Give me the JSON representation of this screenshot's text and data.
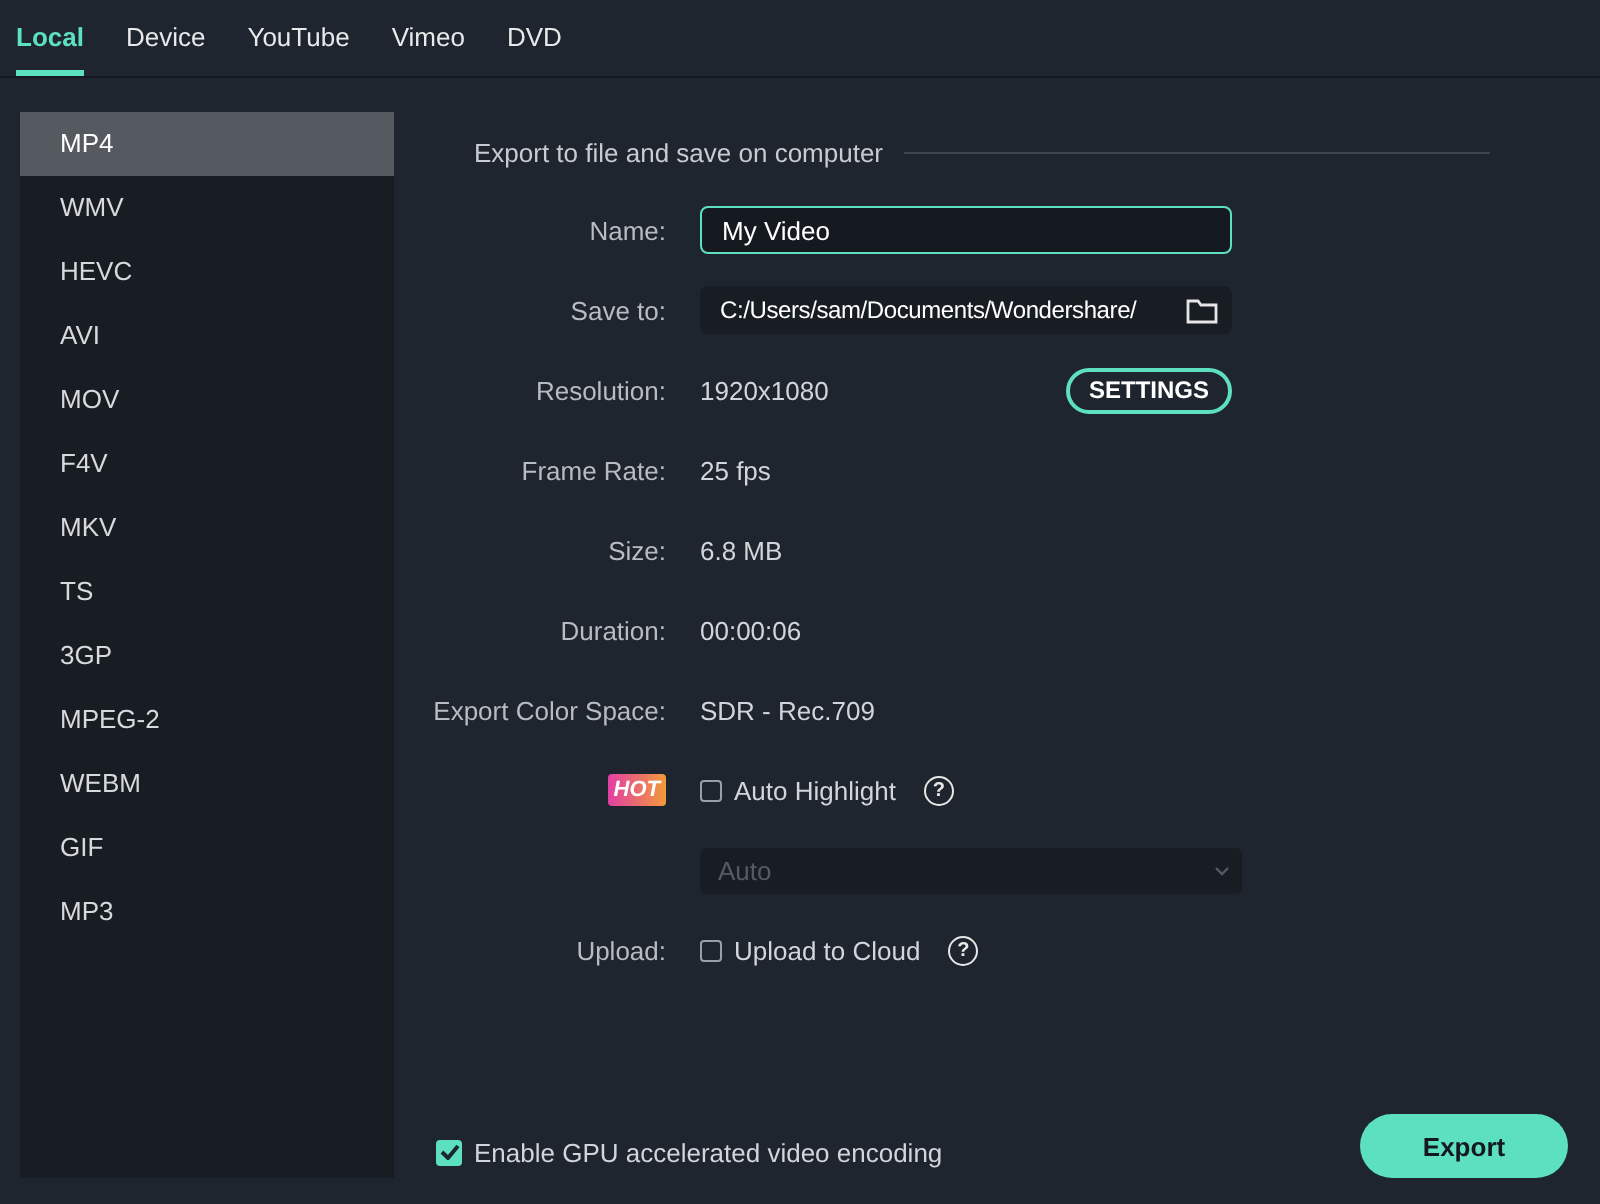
{
  "tabs": [
    {
      "label": "Local",
      "selected": true
    },
    {
      "label": "Device",
      "selected": false
    },
    {
      "label": "YouTube",
      "selected": false
    },
    {
      "label": "Vimeo",
      "selected": false
    },
    {
      "label": "DVD",
      "selected": false
    }
  ],
  "formats": [
    {
      "label": "MP4",
      "selected": true
    },
    {
      "label": "WMV",
      "selected": false
    },
    {
      "label": "HEVC",
      "selected": false
    },
    {
      "label": "AVI",
      "selected": false
    },
    {
      "label": "MOV",
      "selected": false
    },
    {
      "label": "F4V",
      "selected": false
    },
    {
      "label": "MKV",
      "selected": false
    },
    {
      "label": "TS",
      "selected": false
    },
    {
      "label": "3GP",
      "selected": false
    },
    {
      "label": "MPEG-2",
      "selected": false
    },
    {
      "label": "WEBM",
      "selected": false
    },
    {
      "label": "GIF",
      "selected": false
    },
    {
      "label": "MP3",
      "selected": false
    }
  ],
  "section_title": "Export to file and save on computer",
  "rows": [
    {
      "kind": "input",
      "label": "Name:",
      "value": "My Video",
      "focused": true
    },
    {
      "kind": "path",
      "label": "Save to:",
      "value": "C:/Users/sam/Documents/Wondershare/"
    },
    {
      "kind": "text",
      "label": "Resolution:",
      "value": "1920x1080",
      "button": "SETTINGS"
    },
    {
      "kind": "text",
      "label": "Frame Rate:",
      "value": "25 fps"
    },
    {
      "kind": "text",
      "label": "Size:",
      "value": "6.8 MB"
    },
    {
      "kind": "text",
      "label": "Duration:",
      "value": "00:00:06"
    },
    {
      "kind": "text",
      "label": "Export Color Space:",
      "value": "SDR - Rec.709"
    },
    {
      "kind": "checkbox",
      "badge": "HOT",
      "value": "Auto Highlight",
      "checked": false,
      "help": "?"
    },
    {
      "kind": "select",
      "value": "Auto",
      "disabled": true
    },
    {
      "kind": "checkbox",
      "label": "Upload:",
      "value": "Upload to Cloud",
      "checked": false,
      "help": "?"
    }
  ],
  "gpu": {
    "label": "Enable GPU accelerated video encoding",
    "checked": true
  },
  "export_button": "Export"
}
